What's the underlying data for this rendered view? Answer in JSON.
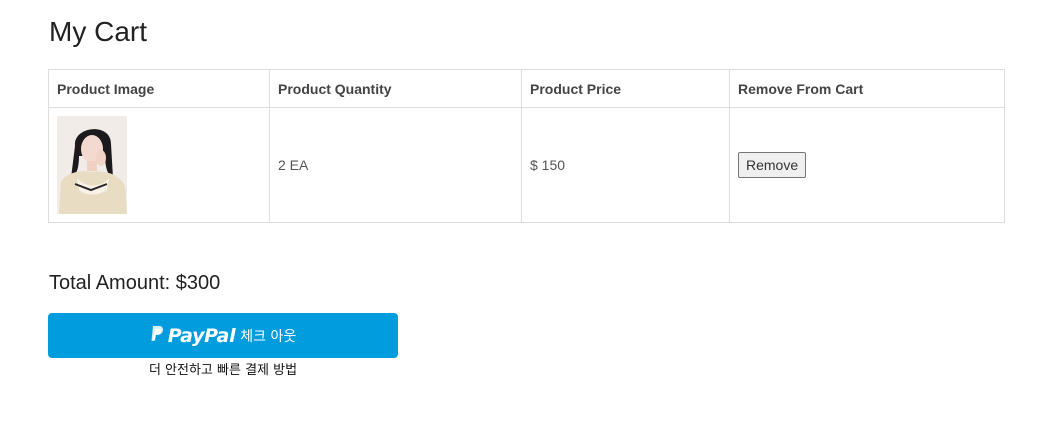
{
  "page": {
    "title": "My Cart"
  },
  "cart_table": {
    "headers": [
      "Product Image",
      "Product Quantity",
      "Product Price",
      "Remove From Cart"
    ],
    "rows": [
      {
        "quantity": "2 EA",
        "price": "$ 150",
        "remove_label": "Remove"
      }
    ]
  },
  "summary": {
    "total": "Total Amount: $300"
  },
  "paypal": {
    "brand": "PayPal",
    "checkout_label": "체크 아웃",
    "tagline": "더 안전하고 빠른 결제 방법",
    "color": "#009cde"
  },
  "icons": {
    "paypal_mark": "paypal-p-icon"
  }
}
